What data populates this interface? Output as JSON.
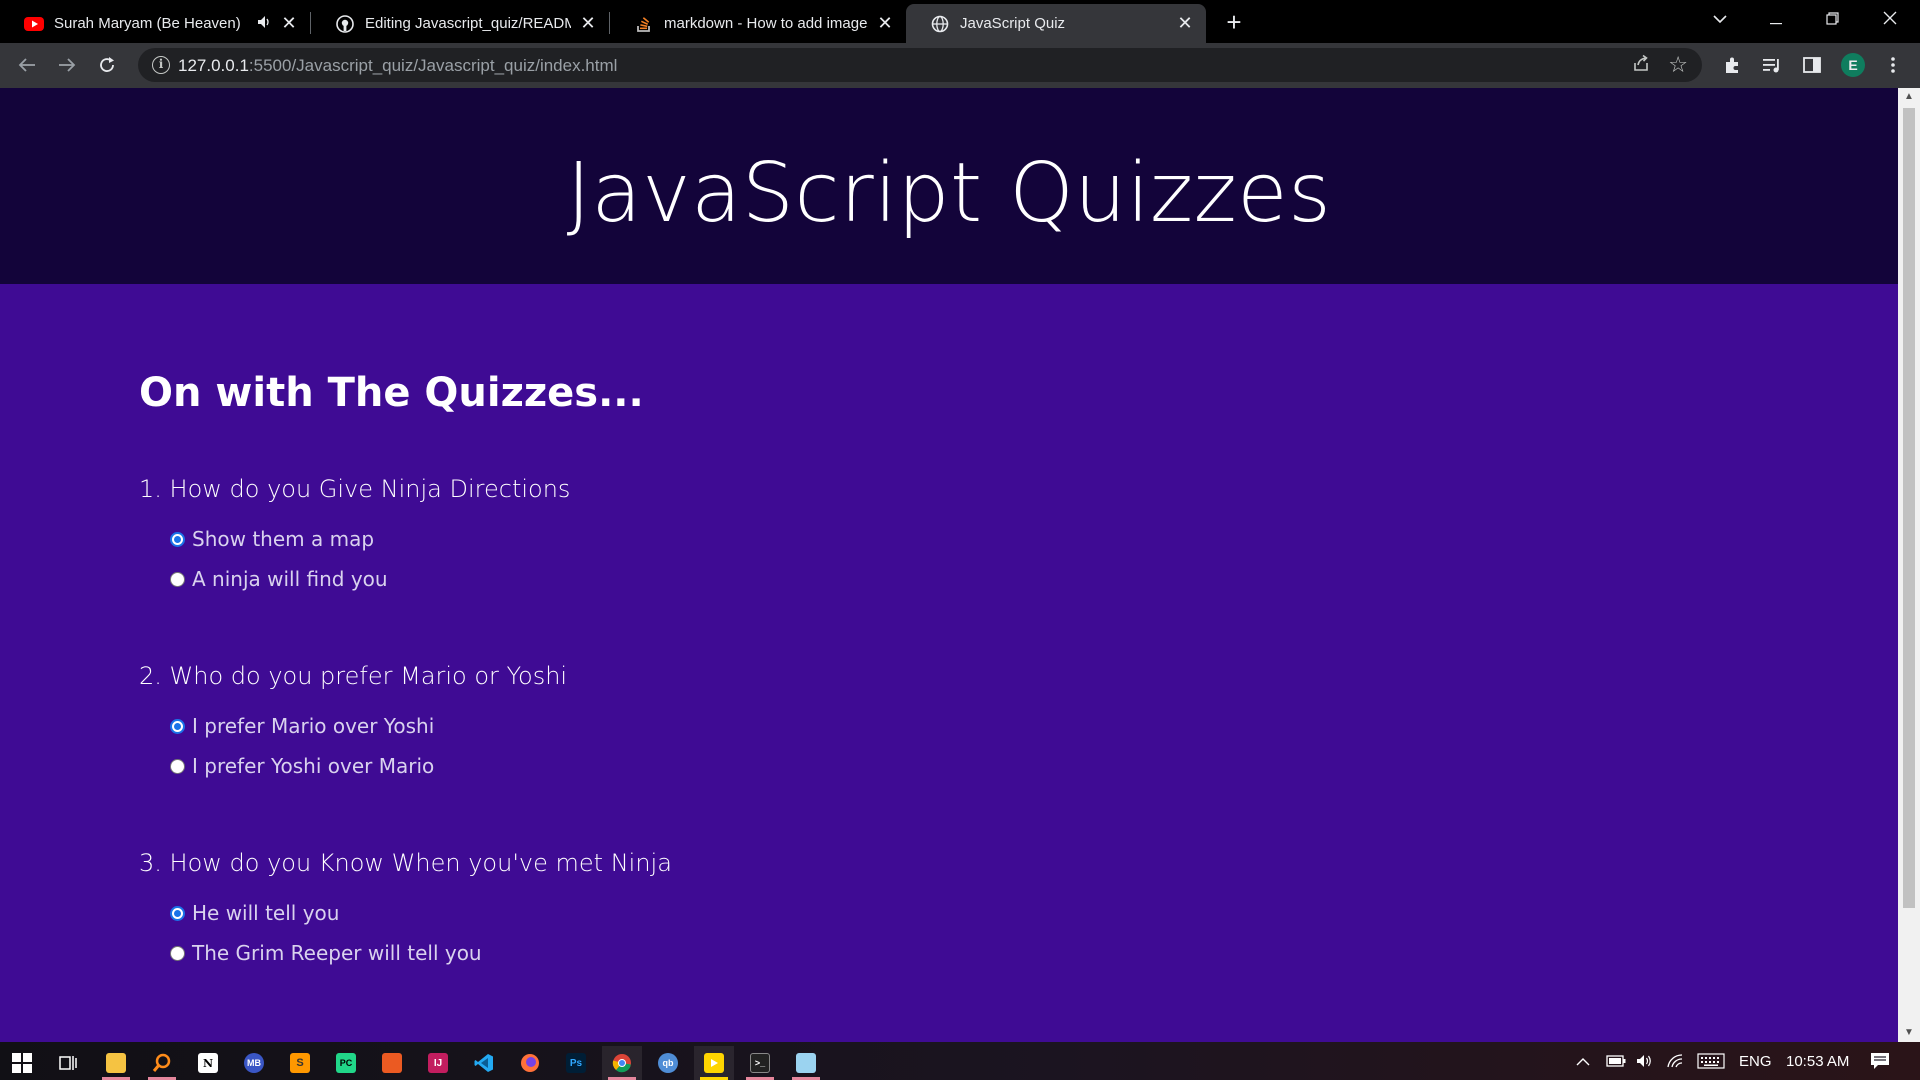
{
  "browser": {
    "tabs": [
      {
        "title": "Surah Maryam (Be Heaven) ",
        "icon": "youtube-icon",
        "muted_label": "🔈"
      },
      {
        "title": "Editing Javascript_quiz/README.r",
        "icon": "github-icon"
      },
      {
        "title": "markdown - How to add images",
        "icon": "stackoverflow-icon"
      },
      {
        "title": "JavaScript Quiz",
        "icon": "globe-icon"
      }
    ],
    "new_tab_label": "+",
    "url_host": "127.0.0.1",
    "url_path": ":5500/Javascript_quiz/Javascript_quiz/index.html",
    "profile_initial": "E"
  },
  "page": {
    "site_title": "JavaScript Quizzes",
    "section_heading": "On with The Quizzes...",
    "questions": [
      {
        "text": "1. How do you Give Ninja Directions",
        "options": [
          {
            "label": "Show them a map",
            "checked": true
          },
          {
            "label": "A ninja will find you",
            "checked": false
          }
        ]
      },
      {
        "text": "2. Who do you prefer Mario or Yoshi",
        "options": [
          {
            "label": "I prefer Mario over Yoshi",
            "checked": true
          },
          {
            "label": "I prefer Yoshi over Mario",
            "checked": false
          }
        ]
      },
      {
        "text": "3. How do you Know When you've met Ninja",
        "options": [
          {
            "label": "He will tell you",
            "checked": true
          },
          {
            "label": "The Grim Reeper will tell you",
            "checked": false
          }
        ]
      }
    ]
  },
  "taskbar": {
    "language": "ENG",
    "time": "10:53 AM"
  },
  "colors": {
    "page_background": "#3f0b94",
    "header_background": "#13043a",
    "radio_accent": "#1a73e8"
  }
}
